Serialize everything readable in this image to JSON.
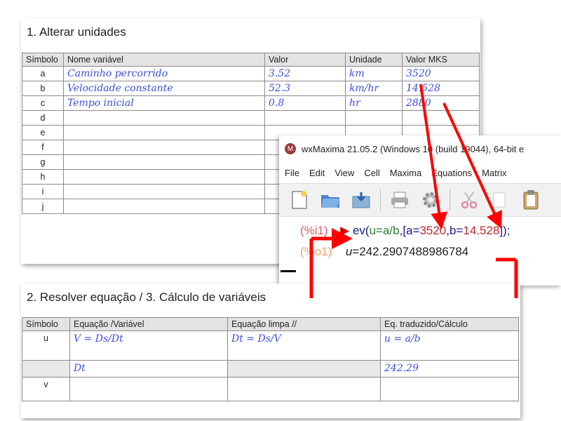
{
  "panel1": {
    "title": "1. Alterar unidades",
    "headers": [
      "Símbolo",
      "Nome variável",
      "Valor",
      "Unidade",
      "Valor MKS"
    ],
    "rows": [
      {
        "sym": "a",
        "name": "Caminho percorrido",
        "value": "3.52",
        "unit": "km",
        "mks": "3520"
      },
      {
        "sym": "b",
        "name": "Velocidade constante",
        "value": "52.3",
        "unit": "km/hr",
        "mks": "14.528"
      },
      {
        "sym": "c",
        "name": "Tempo inicial",
        "value": "0.8",
        "unit": "hr",
        "mks": "2880"
      },
      {
        "sym": "d",
        "name": "",
        "value": "",
        "unit": "",
        "mks": ""
      },
      {
        "sym": "e",
        "name": "",
        "value": "",
        "unit": "",
        "mks": ""
      },
      {
        "sym": "f",
        "name": "",
        "value": "",
        "unit": "",
        "mks": ""
      },
      {
        "sym": "g",
        "name": "",
        "value": "",
        "unit": "",
        "mks": ""
      },
      {
        "sym": "h",
        "name": "",
        "value": "",
        "unit": "",
        "mks": ""
      },
      {
        "sym": "i",
        "name": "",
        "value": "",
        "unit": "",
        "mks": ""
      },
      {
        "sym": "j",
        "name": "",
        "value": "",
        "unit": "",
        "mks": ""
      }
    ]
  },
  "wxmaxima": {
    "title": "wxMaxima 21.05.2 (Windows 10 (build 19044), 64-bit e",
    "logo": "M",
    "menu": [
      "File",
      "Edit",
      "View",
      "Cell",
      "Maxima",
      "Equations",
      "Matrix"
    ],
    "toolbar_icons": [
      "new-file-icon",
      "open-folder-icon",
      "save-icon",
      "print-icon",
      "settings-icon",
      "cut-icon",
      "copy-icon",
      "paste-icon"
    ],
    "input_label": "(%i1)",
    "input_fn": "ev(",
    "input_u": "u=a/b",
    "input_rest1": ",[a=",
    "input_a": "3520",
    "input_rest2": ",b=",
    "input_b": "14.528",
    "input_end": "]);",
    "output_label": "(%o1)",
    "output_var": "u",
    "output_eq": "=",
    "output_value": "242.2907488986784"
  },
  "panel2": {
    "title": "2. Resolver equação / 3. Cálculo de variáveis",
    "headers": [
      "Símbolo",
      "Equação /Variável",
      "Equação limpa //",
      "Eq. traduzido/Cálculo"
    ],
    "rows": [
      {
        "sym": "u",
        "eq": "V = Ds/Dt",
        "clean": "Dt = Ds/V",
        "calc": "u = a/b"
      },
      {
        "sym": "",
        "eq": "Dt",
        "clean": "",
        "calc": "242.29"
      },
      {
        "sym": "v",
        "eq": "",
        "clean": "",
        "calc": ""
      }
    ]
  },
  "colors": {
    "handwriting": "#3b4fd8",
    "arrow": "#ff0000",
    "header_bg": "#e3e3e3"
  }
}
